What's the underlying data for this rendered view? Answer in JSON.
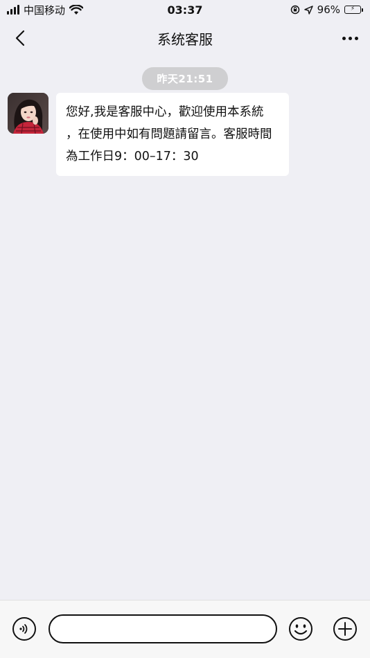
{
  "status_bar": {
    "carrier": "中国移动",
    "time": "03:37",
    "battery_percent": "96%",
    "battery_level": 0.96,
    "battery_color": "#3cc24a",
    "icons": [
      "signal-icon",
      "wifi-icon",
      "rotation-lock-icon",
      "location-arrow-icon",
      "battery-charging-icon"
    ]
  },
  "nav": {
    "title": "系统客服",
    "back_icon": "chevron-left-icon",
    "more_icon": "more-dots-icon"
  },
  "chat": {
    "timestamp": "昨天21:51",
    "messages": [
      {
        "sender": "system-customer-service",
        "avatar": "avatar-photo",
        "text": "您好,我是客服中心，歡迎使用本系統\n，在使用中如有問題請留言。客服時間\n為工作日9：00–17：30"
      }
    ]
  },
  "input_bar": {
    "message_value": "",
    "placeholder": "",
    "icons": [
      "voice-icon",
      "emoji-icon",
      "plus-icon"
    ]
  },
  "colors": {
    "background": "#efeff4",
    "bubble": "#ffffff",
    "timestamp_pill": "#cfcfd1"
  }
}
